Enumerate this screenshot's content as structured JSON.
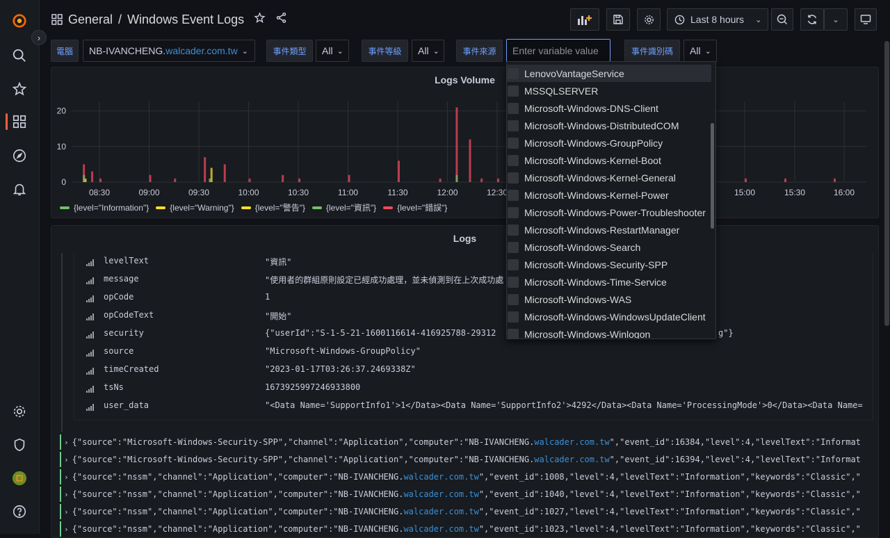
{
  "breadcrumb": {
    "folder": "General",
    "separator": "/",
    "dashboard": "Windows Event Logs"
  },
  "toolbar": {
    "time_range": "Last 8 hours"
  },
  "variables": [
    {
      "label": "電腦",
      "value": "NB-IVANCHENG.",
      "redacted_suffix": "walcader.com.tw"
    },
    {
      "label": "事件類型",
      "value": "All"
    },
    {
      "label": "事件等級",
      "value": "All"
    },
    {
      "label": "事件來源",
      "placeholder": "Enter variable value"
    },
    {
      "label": "事件識別碼",
      "value": "All"
    }
  ],
  "logs_volume": {
    "title": "Logs Volume",
    "y_ticks": [
      "20",
      "10",
      "0"
    ],
    "x_ticks": [
      "08:30",
      "09:00",
      "09:30",
      "10:00",
      "10:30",
      "11:00",
      "11:30",
      "12:00",
      "12:30",
      "15:00",
      "15:30",
      "16:00"
    ],
    "legend": [
      {
        "name": "{level=\"Information\"}",
        "color": "#73bf69"
      },
      {
        "name": "{level=\"Warning\"}",
        "color": "#fade2a"
      },
      {
        "name": "{level=\"警告\"}",
        "color": "#fade2a"
      },
      {
        "name": "{level=\"資訊\"}",
        "color": "#73bf69"
      },
      {
        "name": "{level=\"錯誤\"}",
        "color": "#f2495c"
      }
    ]
  },
  "chart_data": {
    "type": "bar",
    "ylim": [
      0,
      25
    ],
    "y_ticks": [
      0,
      10,
      20
    ],
    "x_ticks": [
      "08:30",
      "09:00",
      "09:30",
      "10:00",
      "10:30",
      "11:00",
      "11:30",
      "12:00",
      "12:30",
      "15:00",
      "15:30",
      "16:00"
    ],
    "series": [
      {
        "name": "{level=\"錯誤\"}",
        "color": "#f2495c",
        "x": [
          "08:20",
          "08:25",
          "08:30",
          "09:00",
          "09:15",
          "09:33",
          "09:45",
          "10:00",
          "10:20",
          "10:30",
          "11:00",
          "11:30",
          "11:55",
          "12:05",
          "12:13",
          "12:20",
          "12:30",
          "15:00",
          "15:30",
          "16:00"
        ],
        "values": [
          5,
          3,
          1,
          2,
          1,
          7,
          5,
          1,
          2,
          1,
          2,
          6,
          1,
          21,
          12,
          1,
          1,
          1,
          1,
          1
        ]
      },
      {
        "name": "{level=\"Information\"}",
        "color": "#73bf69",
        "x": [
          "08:20",
          "09:36",
          "12:05"
        ],
        "values": [
          2,
          1,
          2
        ]
      },
      {
        "name": "{level=\"Warning\"}",
        "color": "#fade2a",
        "x": [
          "08:21",
          "09:37"
        ],
        "values": [
          1,
          4
        ]
      }
    ]
  },
  "logs_panel": {
    "title": "Logs",
    "fields": [
      {
        "key": "levelText",
        "value": "\"資訊\""
      },
      {
        "key": "message",
        "value": "\"使用者的群組原則設定已經成功處理，並未偵測到在上次成功處"
      },
      {
        "key": "opCode",
        "value": "1"
      },
      {
        "key": "opCodeText",
        "value": "\"開始\""
      },
      {
        "key": "security",
        "value": "{\"userId\":\"S-1-5-21-1600116614-416925788-29312",
        "value_tail": "g\"}"
      },
      {
        "key": "source",
        "value": "\"Microsoft-Windows-GroupPolicy\""
      },
      {
        "key": "timeCreated",
        "value": "\"2023-01-17T03:26:37.2469338Z\""
      },
      {
        "key": "tsNs",
        "value": "1673925997246933800"
      },
      {
        "key": "user_data",
        "value": "\"<Data Name='SupportInfo1'>1</Data><Data Name='SupportInfo2'>4292</Data><Data Name='ProcessingMode'>0</Data><Data Name="
      }
    ],
    "lines": [
      {
        "pre": "{\"source\":\"Microsoft-Windows-Security-SPP\",\"channel\":\"Application\",\"computer\":\"NB-IVANCHENG.",
        "redacted": "walcader.com.tw",
        "post": "\",\"event_id\":16384,\"level\":4,\"levelText\":\"Informat"
      },
      {
        "pre": "{\"source\":\"Microsoft-Windows-Security-SPP\",\"channel\":\"Application\",\"computer\":\"NB-IVANCHENG.",
        "redacted": "walcader.com.tw",
        "post": "\",\"event_id\":16394,\"level\":4,\"levelText\":\"Informat"
      },
      {
        "pre": "{\"source\":\"nssm\",\"channel\":\"Application\",\"computer\":\"NB-IVANCHENG.",
        "redacted": "walcader.com.tw",
        "post": "\",\"event_id\":1008,\"level\":4,\"levelText\":\"Information\",\"keywords\":\"Classic\",\""
      },
      {
        "pre": "{\"source\":\"nssm\",\"channel\":\"Application\",\"computer\":\"NB-IVANCHENG.",
        "redacted": "walcader.com.tw",
        "post": "\",\"event_id\":1040,\"level\":4,\"levelText\":\"Information\",\"keywords\":\"Classic\",\""
      },
      {
        "pre": "{\"source\":\"nssm\",\"channel\":\"Application\",\"computer\":\"NB-IVANCHENG.",
        "redacted": "walcader.com.tw",
        "post": "\",\"event_id\":1027,\"level\":4,\"levelText\":\"Information\",\"keywords\":\"Classic\",\""
      },
      {
        "pre": "{\"source\":\"nssm\",\"channel\":\"Application\",\"computer\":\"NB-IVANCHENG.",
        "redacted": "walcader.com.tw",
        "post": "\",\"event_id\":1023,\"level\":4,\"levelText\":\"Information\",\"keywords\":\"Classic\",\""
      }
    ]
  },
  "dropdown": {
    "options": [
      "LenovoVantageService",
      "MSSQLSERVER",
      "Microsoft-Windows-DNS-Client",
      "Microsoft-Windows-DistributedCOM",
      "Microsoft-Windows-GroupPolicy",
      "Microsoft-Windows-Kernel-Boot",
      "Microsoft-Windows-Kernel-General",
      "Microsoft-Windows-Kernel-Power",
      "Microsoft-Windows-Power-Troubleshooter",
      "Microsoft-Windows-RestartManager",
      "Microsoft-Windows-Search",
      "Microsoft-Windows-Security-SPP",
      "Microsoft-Windows-Time-Service",
      "Microsoft-Windows-WAS",
      "Microsoft-Windows-WindowsUpdateClient",
      "Microsoft-Windows-Winlogon"
    ]
  }
}
